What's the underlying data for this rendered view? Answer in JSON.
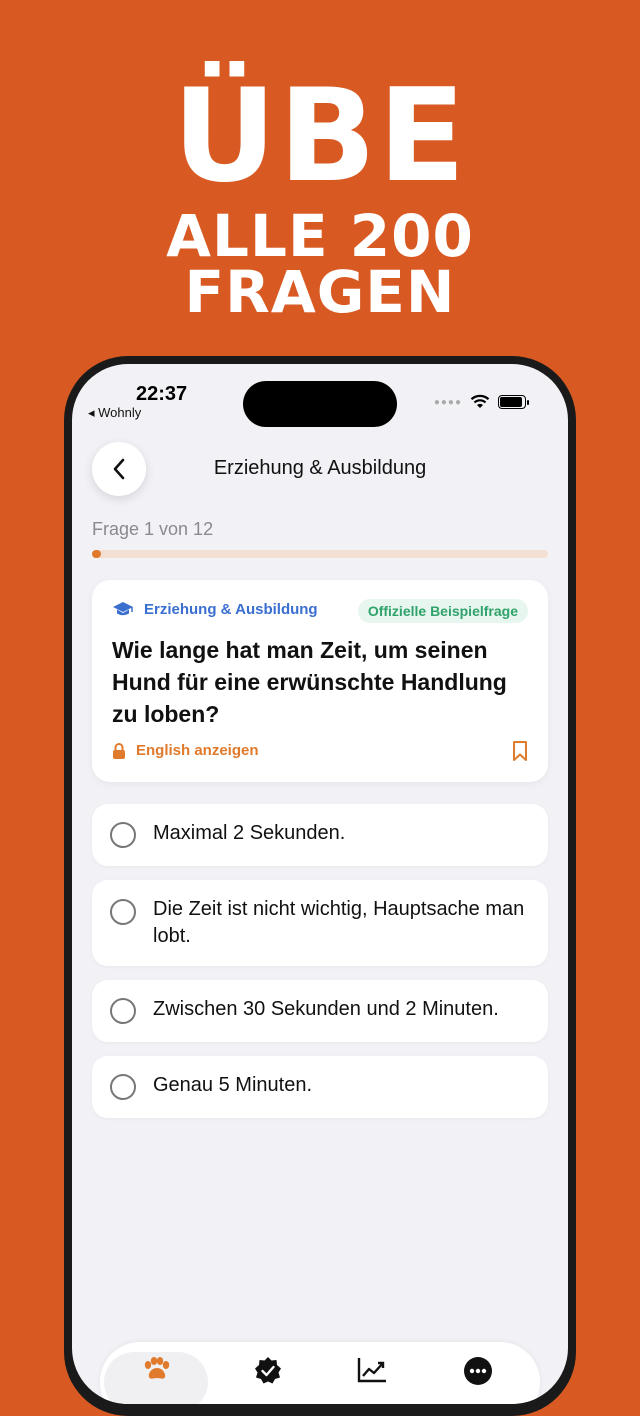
{
  "promo": {
    "title": "ÜBE",
    "subtitle_line1": "ALLE 200",
    "subtitle_line2": "FRAGEN"
  },
  "status_bar": {
    "time": "22:37",
    "back_app": "◂ Wohnly"
  },
  "nav": {
    "title": "Erziehung & Ausbildung"
  },
  "progress": {
    "label": "Frage 1 von 12",
    "current": 1,
    "total": 12,
    "fill_color": "#E07A2C"
  },
  "question": {
    "category": "Erziehung & Ausbildung",
    "category_icon": "graduation-cap-icon",
    "badge": "Offizielle Beispielfrage",
    "text": "Wie lange hat man Zeit, um seinen Hund für eine erwünschte Handlung zu loben?",
    "language_toggle": "English anzeigen",
    "language_icon": "lock-icon",
    "bookmark_icon": "bookmark-icon"
  },
  "answers": [
    {
      "label": "Maximal 2 Sekunden."
    },
    {
      "label": "Die Zeit ist nicht wichtig, Hauptsache man lobt."
    },
    {
      "label": "Zwischen 30 Sekunden und 2 Minuten."
    },
    {
      "label": "Genau 5 Minuten."
    }
  ],
  "tabbar": {
    "tabs": [
      {
        "icon": "paw-icon",
        "active": true
      },
      {
        "icon": "check-badge-icon",
        "active": false
      },
      {
        "icon": "chart-icon",
        "active": false
      },
      {
        "icon": "more-icon",
        "active": false
      }
    ]
  },
  "colors": {
    "background": "#D85A22",
    "accent": "#E07A2C",
    "category_blue": "#3A6FD0",
    "badge_green": "#2FA36B"
  }
}
